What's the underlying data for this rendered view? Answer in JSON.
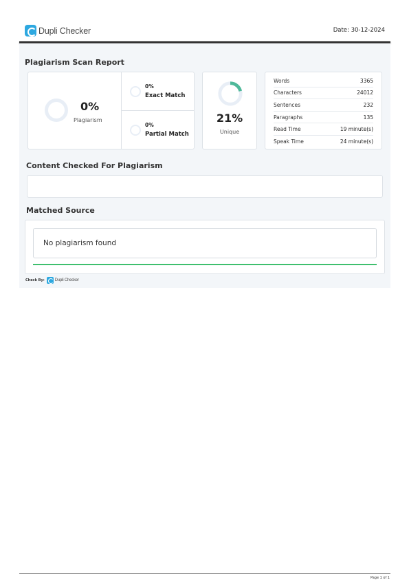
{
  "header": {
    "brand": "Dupli Checker",
    "date": "Date: 30-12-2024"
  },
  "report": {
    "title": "Plagiarism Scan Report",
    "plagiarism": {
      "percent": "0%",
      "label": "Plagiarism"
    },
    "exact_match": {
      "percent": "0%",
      "label": "Exact Match"
    },
    "partial_match": {
      "percent": "0%",
      "label": "Partial Match"
    },
    "unique": {
      "percent": "21%",
      "label": "Unique",
      "fraction": 0.21
    },
    "stats": [
      {
        "label": "Words",
        "value": "3365"
      },
      {
        "label": "Characters",
        "value": "24012"
      },
      {
        "label": "Sentences",
        "value": "232"
      },
      {
        "label": "Paragraphs",
        "value": "135"
      },
      {
        "label": "Read Time",
        "value": "19 minute(s)"
      },
      {
        "label": "Speak Time",
        "value": "24 minute(s)"
      }
    ]
  },
  "content_checked": {
    "title": "Content Checked For Plagiarism",
    "text": ""
  },
  "matched_source": {
    "title": "Matched Source",
    "result": "No plagiarism found"
  },
  "footer": {
    "check_by_label": "Check By:",
    "check_by_brand": "Dupli Checker",
    "page": "Page 1 of 1"
  },
  "colors": {
    "accent_green": "#3fbf6e",
    "unique_ring": "#4fb99a",
    "ring_track": "#e8eef6",
    "brand_blue": "#2da8e0"
  }
}
